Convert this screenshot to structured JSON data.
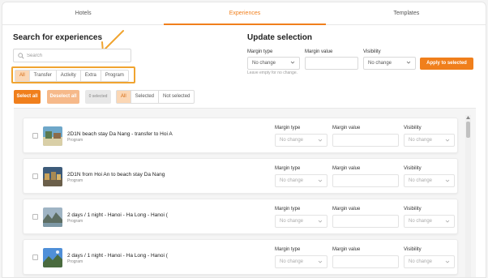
{
  "tabs": [
    {
      "label": "Hotels",
      "active": false
    },
    {
      "label": "Experiences",
      "active": true
    },
    {
      "label": "Templates",
      "active": false
    }
  ],
  "search": {
    "title": "Search for experiences",
    "placeholder": "Search",
    "filters": [
      "All",
      "Transfer",
      "Activity",
      "Extra",
      "Program"
    ],
    "active_filter": "All"
  },
  "bulk": {
    "select_all": "Select all",
    "deselect_all": "Deselect all",
    "selected_count": "0 selected",
    "view_filters": [
      "All",
      "Selected",
      "Not selected"
    ],
    "active_view": "All"
  },
  "update": {
    "title": "Update selection",
    "margin_type_label": "Margin type",
    "margin_type_value": "No change",
    "margin_value_label": "Margin value",
    "margin_value": "",
    "visibility_label": "Visibility",
    "visibility_value": "No change",
    "hint": "Leave empty for no change.",
    "apply": "Apply to selected"
  },
  "labels": {
    "margin_type": "Margin type",
    "margin_value": "Margin value",
    "visibility": "Visibility",
    "no_change": "No change"
  },
  "items": [
    {
      "name": "2D1N beach stay Da Nang - transfer to Hoi A",
      "type": "Program",
      "thumb": "beach"
    },
    {
      "name": "2D1N from Hoi An to beach stay Da Nang",
      "type": "Program",
      "thumb": "town"
    },
    {
      "name": "2 days / 1 night - Hanoi - Ha Long - Hanoi (",
      "type": "Program",
      "thumb": "bay"
    },
    {
      "name": "2 days / 1 night - Hanoi - Ha Long - Hanoi (",
      "type": "Program",
      "thumb": "sky"
    }
  ],
  "colors": {
    "accent": "#f07f1c",
    "accent_light": "#fbd7b5",
    "highlight_border": "#f0a430"
  }
}
